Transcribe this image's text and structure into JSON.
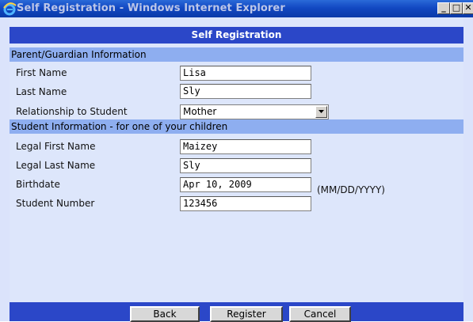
{
  "window": {
    "title": "Self Registration - Windows Internet Explorer",
    "minimize_label": "_",
    "maximize_label": "□",
    "close_label": "✕"
  },
  "form": {
    "header": "Self Registration",
    "parent_section": "Parent/Guardian Information",
    "student_section": "Student Information - for one of your children",
    "fields": {
      "first_name": {
        "label": "First Name",
        "value": "Lisa"
      },
      "last_name": {
        "label": "Last Name",
        "value": "Sly"
      },
      "relationship": {
        "label": "Relationship to Student",
        "value": "Mother"
      },
      "legal_first_name": {
        "label": "Legal First Name",
        "value": "Maizey"
      },
      "legal_last_name": {
        "label": "Legal Last Name",
        "value": "Sly"
      },
      "birthdate": {
        "label": "Birthdate",
        "value": "Apr 10, 2009",
        "hint": "(MM/DD/YYYY)"
      },
      "student_number": {
        "label": "Student Number",
        "value": "123456"
      }
    }
  },
  "buttons": {
    "back": "Back",
    "register": "Register",
    "cancel": "Cancel"
  },
  "icons": {
    "browser": "internet-explorer-icon",
    "dropdown": "chevron-down-icon"
  },
  "colors": {
    "titlebar": "#1248c2",
    "header_bar": "#2b47c8",
    "section_bar": "#8eaef0",
    "form_background": "#dde6fb"
  }
}
